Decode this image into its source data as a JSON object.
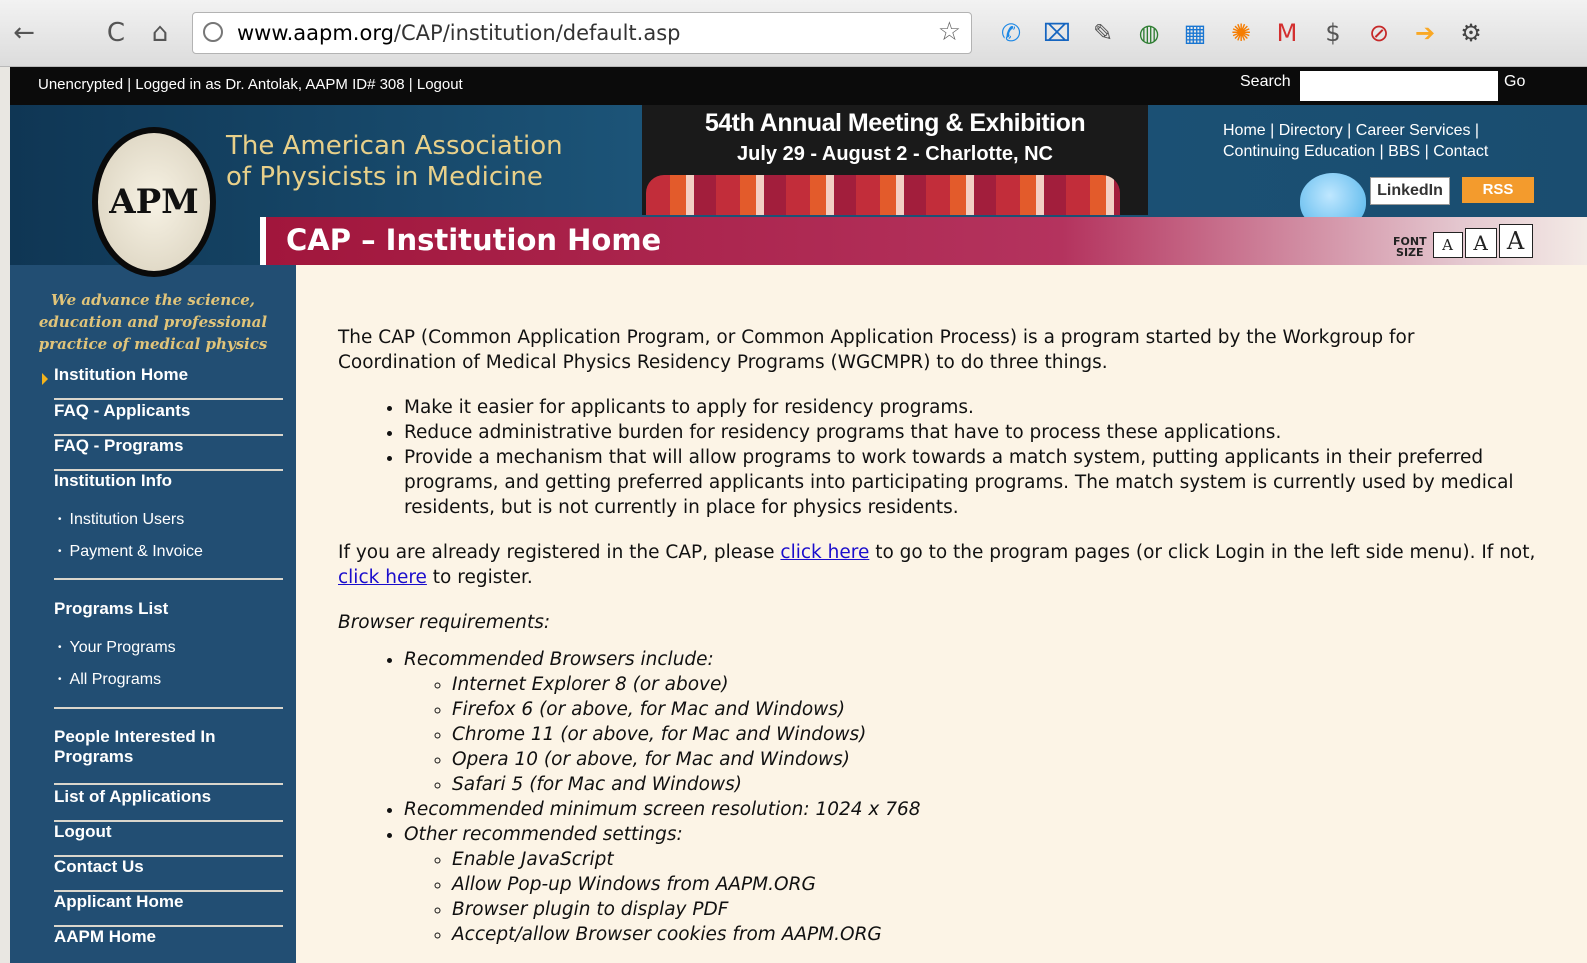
{
  "browser": {
    "url_host": "www.aapm.org",
    "url_path": "/CAP/institution/default.asp",
    "back_glyph": "←",
    "reload_glyph": "C",
    "home_glyph": "⌂",
    "star_glyph": "☆",
    "extensions": [
      {
        "name": "phone-icon",
        "glyph": "✆",
        "color": "#1e88e5"
      },
      {
        "name": "bookmark-x-icon",
        "glyph": "⌧",
        "color": "#1565c0"
      },
      {
        "name": "wrench-icon",
        "glyph": "✎",
        "color": "#555555"
      },
      {
        "name": "magnify-icon",
        "glyph": "◍",
        "color": "#2e7d32"
      },
      {
        "name": "calendar-icon",
        "glyph": "▦",
        "color": "#1976d2"
      },
      {
        "name": "sync-icon",
        "glyph": "✺",
        "color": "#f57c00"
      },
      {
        "name": "gmail-icon",
        "glyph": "M",
        "color": "#d32f2f"
      },
      {
        "name": "dollar-icon",
        "glyph": "$",
        "color": "#555555"
      },
      {
        "name": "stop-icon",
        "glyph": "⊘",
        "color": "#c62828"
      },
      {
        "name": "phone-arrow-icon",
        "glyph": "➔",
        "color": "#f9a825"
      },
      {
        "name": "gear-icon",
        "glyph": "⚙",
        "color": "#444444"
      }
    ]
  },
  "topbar": {
    "login_info": "Unencrypted | Logged in as Dr. Antolak, AAPM ID# 308 | Logout",
    "search_label": "Search",
    "search_value": "",
    "go_label": "Go"
  },
  "header": {
    "org_line1": "The American Association",
    "org_line2": "of Physicists in Medicine",
    "logo_text": "APM",
    "meeting_title": "54th Annual Meeting & Exhibition",
    "meeting_dates": "July 29 - August 2 - Charlotte, NC",
    "links_line1": "Home | Directory | Career Services |",
    "links_line2": "Continuing Education | BBS | Contact",
    "linkedin_label": "LinkedIn",
    "rss_label": "RSS",
    "page_title": "CAP – Institution Home",
    "font_size_label_1": "FONT",
    "font_size_label_2": "SIZE",
    "font_glyph": "A"
  },
  "sidebar": {
    "tagline_1": "We advance the science,",
    "tagline_2": "education and professional",
    "tagline_3": "practice of medical physics",
    "items": [
      {
        "label": "Institution Home"
      },
      {
        "label": "FAQ - Applicants"
      },
      {
        "label": "FAQ - Programs"
      },
      {
        "label": "Institution Info"
      },
      {
        "label": "Institution Users"
      },
      {
        "label": "Payment & Invoice"
      },
      {
        "label": "Programs List"
      },
      {
        "label": "Your Programs"
      },
      {
        "label": "All Programs"
      },
      {
        "label": "People Interested In"
      },
      {
        "label": "Programs"
      },
      {
        "label": "List of Applications"
      },
      {
        "label": "Logout"
      },
      {
        "label": "Contact Us"
      },
      {
        "label": "Applicant Home"
      },
      {
        "label": "AAPM Home"
      }
    ]
  },
  "content": {
    "intro_1": "The CAP (Common Application Program, or Common Application Process) is a program started by the Workgroup for",
    "intro_2": "Coordination of Medical Physics Residency Programs (WGCMPR) to do three things.",
    "goals": [
      "Make it easier for applicants to apply for residency programs.",
      "Reduce administrative burden for residency programs that have to process these applications.",
      "Provide a mechanism that will allow programs to work towards a match system, putting applicants in their preferred programs, and getting preferred applicants into participating programs. The match system is currently used by medical residents, but is not currently in place for physics residents."
    ],
    "registered_1": "If you are already registered in the CAP, please ",
    "click_here_1": "click here",
    "registered_2": " to go to the program pages (or click Login in the left side menu). If not, ",
    "click_here_2": "click here",
    "registered_3": " to register.",
    "browser_req_title": "Browser requirements:",
    "recommended_browsers_title": "Recommended Browsers include:",
    "browsers": [
      "Internet Explorer 8 (or above)",
      "Firefox 6 (or above, for Mac and Windows)",
      "Chrome 11 (or above, for Mac and Windows)",
      "Opera 10 (or above, for Mac and Windows)",
      "Safari 5 (for Mac and Windows)"
    ],
    "min_resolution": "Recommended minimum screen resolution: 1024 x 768",
    "other_settings_title": "Other recommended settings:",
    "settings": [
      "Enable JavaScript",
      "Allow Pop-up Windows from AAPM.ORG",
      "Browser plugin to display PDF",
      "Accept/allow Browser cookies from AAPM.ORG"
    ]
  }
}
